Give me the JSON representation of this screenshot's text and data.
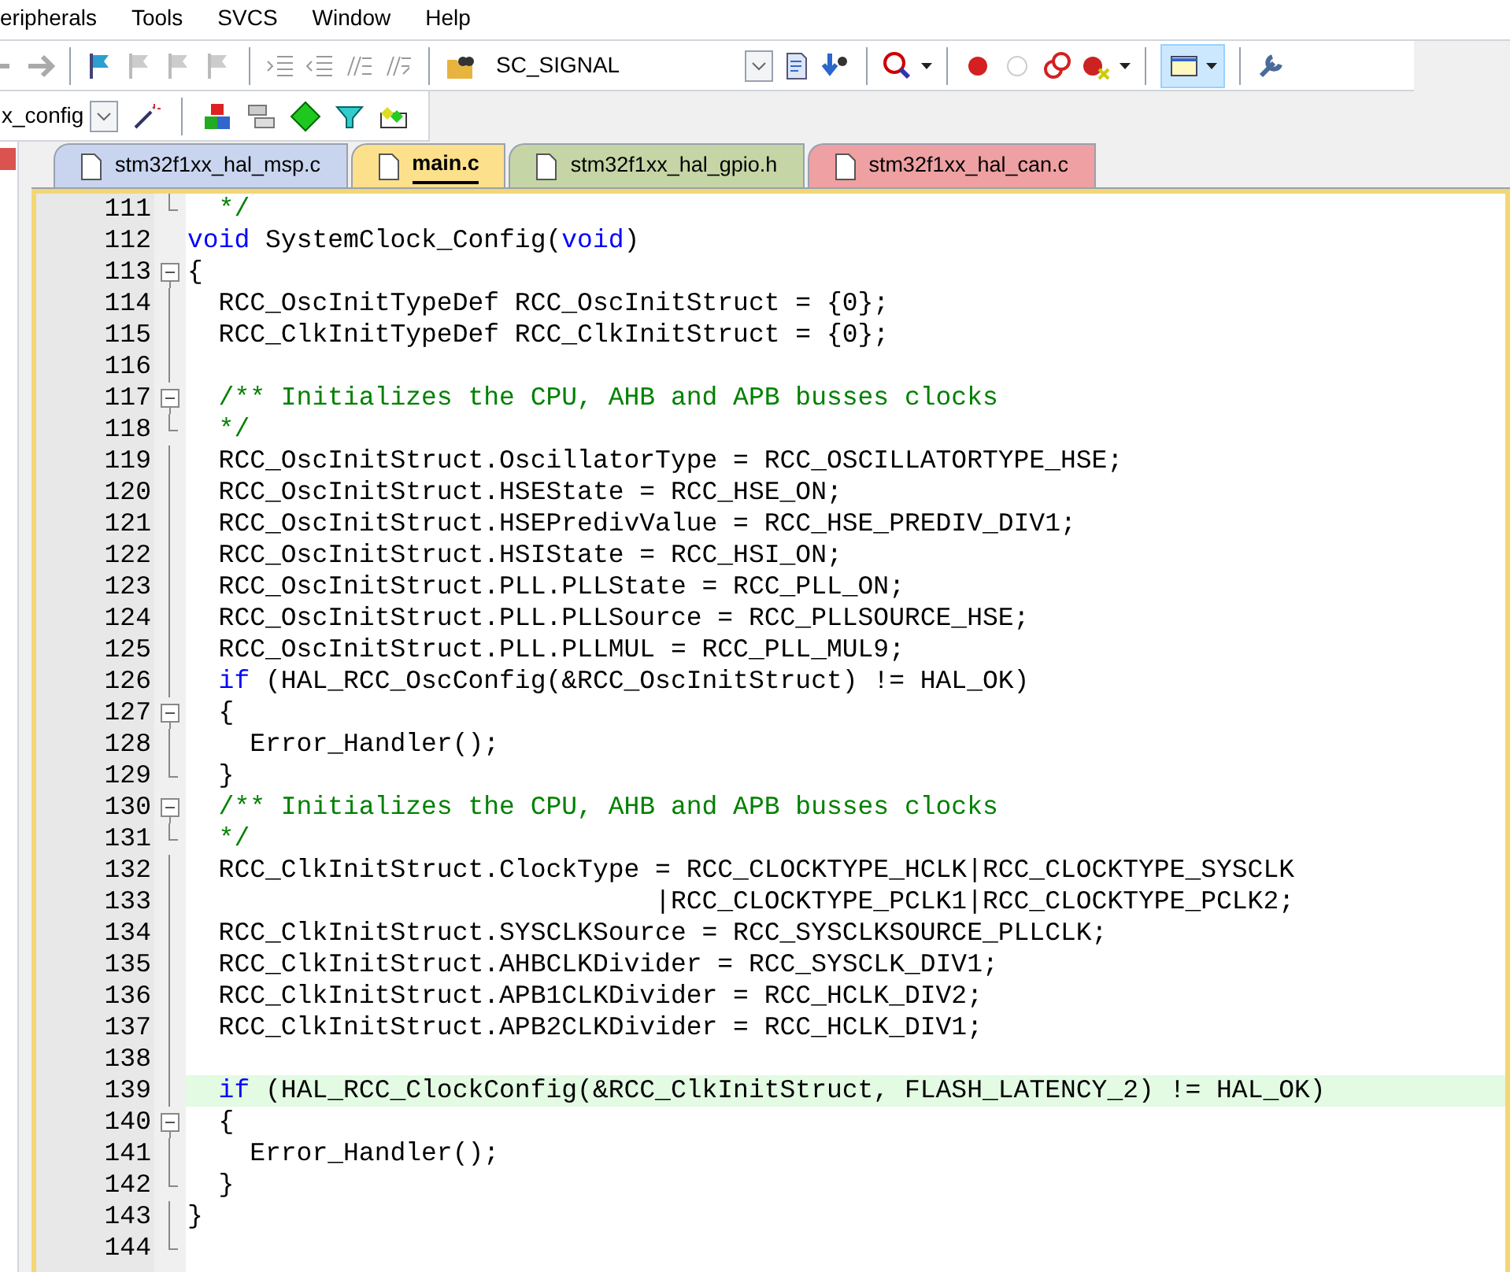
{
  "menu": [
    "eripherals",
    "Tools",
    "SVCS",
    "Window",
    "Help"
  ],
  "toolbar": {
    "signal_combo": "SC_SIGNAL",
    "target_combo": "x_config",
    "view_toggle_selected": true
  },
  "tabs": [
    {
      "label": "stm32f1xx_hal_msp.c",
      "color": "#c9d5ef",
      "selected": false
    },
    {
      "label": "main.c",
      "color": "#fde08c",
      "selected": true
    },
    {
      "label": "stm32f1xx_hal_gpio.h",
      "color": "#c5d5a6",
      "selected": false
    },
    {
      "label": "stm32f1xx_hal_can.c",
      "color": "#eea0a2",
      "selected": false
    }
  ],
  "editor": {
    "lines": [
      {
        "number": "111",
        "kind": "end",
        "highlighted": false,
        "segments": [
          {
            "kind": "comment",
            "text": "  */"
          }
        ]
      },
      {
        "number": "112",
        "kind": "plain",
        "highlighted": false,
        "segments": [
          {
            "kind": "keyword",
            "text": "void"
          },
          {
            "kind": "code",
            "text": " SystemClock_Config("
          },
          {
            "kind": "keyword",
            "text": "void"
          },
          {
            "kind": "code",
            "text": ")"
          }
        ]
      },
      {
        "number": "113",
        "kind": "open",
        "highlighted": false,
        "segments": [
          {
            "kind": "code",
            "text": "{"
          }
        ]
      },
      {
        "number": "114",
        "kind": "line",
        "highlighted": false,
        "segments": [
          {
            "kind": "code",
            "text": "  RCC_OscInitTypeDef RCC_OscInitStruct = {0};"
          }
        ]
      },
      {
        "number": "115",
        "kind": "line",
        "highlighted": false,
        "segments": [
          {
            "kind": "code",
            "text": "  RCC_ClkInitTypeDef RCC_ClkInitStruct = {0};"
          }
        ]
      },
      {
        "number": "116",
        "kind": "line",
        "highlighted": false
      },
      {
        "number": "117",
        "kind": "open",
        "highlighted": false,
        "segments": [
          {
            "kind": "comment",
            "text": "  /** Initializes the CPU, AHB and APB busses clocks"
          }
        ]
      },
      {
        "number": "118",
        "kind": "end",
        "highlighted": false,
        "segments": [
          {
            "kind": "comment",
            "text": "  */"
          }
        ]
      },
      {
        "number": "119",
        "kind": "line",
        "highlighted": false,
        "segments": [
          {
            "kind": "code",
            "text": "  RCC_OscInitStruct.OscillatorType = RCC_OSCILLATORTYPE_HSE;"
          }
        ]
      },
      {
        "number": "120",
        "kind": "line",
        "highlighted": false,
        "segments": [
          {
            "kind": "code",
            "text": "  RCC_OscInitStruct.HSEState = RCC_HSE_ON;"
          }
        ]
      },
      {
        "number": "121",
        "kind": "line",
        "highlighted": false,
        "segments": [
          {
            "kind": "code",
            "text": "  RCC_OscInitStruct.HSEPredivValue = RCC_HSE_PREDIV_DIV1;"
          }
        ]
      },
      {
        "number": "122",
        "kind": "line",
        "highlighted": false,
        "segments": [
          {
            "kind": "code",
            "text": "  RCC_OscInitStruct.HSIState = RCC_HSI_ON;"
          }
        ]
      },
      {
        "number": "123",
        "kind": "line",
        "highlighted": false,
        "segments": [
          {
            "kind": "code",
            "text": "  RCC_OscInitStruct.PLL.PLLState = RCC_PLL_ON;"
          }
        ]
      },
      {
        "number": "124",
        "kind": "line",
        "highlighted": false,
        "segments": [
          {
            "kind": "code",
            "text": "  RCC_OscInitStruct.PLL.PLLSource = RCC_PLLSOURCE_HSE;"
          }
        ]
      },
      {
        "number": "125",
        "kind": "line",
        "highlighted": false,
        "segments": [
          {
            "kind": "code",
            "text": "  RCC_OscInitStruct.PLL.PLLMUL = RCC_PLL_MUL9;"
          }
        ]
      },
      {
        "number": "126",
        "kind": "line",
        "highlighted": false,
        "segments": [
          {
            "kind": "keyword",
            "text": "  if"
          },
          {
            "kind": "code",
            "text": " (HAL_RCC_OscConfig(&RCC_OscInitStruct) != HAL_OK)"
          }
        ]
      },
      {
        "number": "127",
        "kind": "open",
        "highlighted": false,
        "segments": [
          {
            "kind": "code",
            "text": "  {"
          }
        ]
      },
      {
        "number": "128",
        "kind": "line",
        "highlighted": false,
        "segments": [
          {
            "kind": "code",
            "text": "    Error_Handler();"
          }
        ]
      },
      {
        "number": "129",
        "kind": "end",
        "highlighted": false,
        "segments": [
          {
            "kind": "code",
            "text": "  }"
          }
        ]
      },
      {
        "number": "130",
        "kind": "open",
        "highlighted": false,
        "segments": [
          {
            "kind": "comment",
            "text": "  /** Initializes the CPU, AHB and APB busses clocks"
          }
        ]
      },
      {
        "number": "131",
        "kind": "end",
        "highlighted": false,
        "segments": [
          {
            "kind": "comment",
            "text": "  */"
          }
        ]
      },
      {
        "number": "132",
        "kind": "line",
        "highlighted": false,
        "segments": [
          {
            "kind": "code",
            "text": "  RCC_ClkInitStruct.ClockType = RCC_CLOCKTYPE_HCLK|RCC_CLOCKTYPE_SYSCLK"
          }
        ]
      },
      {
        "number": "133",
        "kind": "line",
        "highlighted": false,
        "segments": [
          {
            "kind": "code",
            "text": "                              |RCC_CLOCKTYPE_PCLK1|RCC_CLOCKTYPE_PCLK2;"
          }
        ]
      },
      {
        "number": "134",
        "kind": "line",
        "highlighted": false,
        "segments": [
          {
            "kind": "code",
            "text": "  RCC_ClkInitStruct.SYSCLKSource = RCC_SYSCLKSOURCE_PLLCLK;"
          }
        ]
      },
      {
        "number": "135",
        "kind": "line",
        "highlighted": false,
        "segments": [
          {
            "kind": "code",
            "text": "  RCC_ClkInitStruct.AHBCLKDivider = RCC_SYSCLK_DIV1;"
          }
        ]
      },
      {
        "number": "136",
        "kind": "line",
        "highlighted": false,
        "segments": [
          {
            "kind": "code",
            "text": "  RCC_ClkInitStruct.APB1CLKDivider = RCC_HCLK_DIV2;"
          }
        ]
      },
      {
        "number": "137",
        "kind": "line",
        "highlighted": false,
        "segments": [
          {
            "kind": "code",
            "text": "  RCC_ClkInitStruct.APB2CLKDivider = RCC_HCLK_DIV1;"
          }
        ]
      },
      {
        "number": "138",
        "kind": "line",
        "highlighted": false
      },
      {
        "number": "139",
        "kind": "line",
        "highlighted": true,
        "segments": [
          {
            "kind": "keyword",
            "text": "  if"
          },
          {
            "kind": "code",
            "text": " (HAL_RCC_ClockConfig(&RCC_ClkInitStruct, FLASH_LATENCY_2) != HAL_OK)"
          }
        ]
      },
      {
        "number": "140",
        "kind": "open",
        "highlighted": false,
        "segments": [
          {
            "kind": "code",
            "text": "  {"
          }
        ]
      },
      {
        "number": "141",
        "kind": "line",
        "highlighted": false,
        "segments": [
          {
            "kind": "code",
            "text": "    Error_Handler();"
          }
        ]
      },
      {
        "number": "142",
        "kind": "end",
        "highlighted": false,
        "segments": [
          {
            "kind": "code",
            "text": "  }"
          }
        ]
      },
      {
        "number": "143",
        "kind": "line",
        "highlighted": false,
        "segments": [
          {
            "kind": "code",
            "text": "}"
          }
        ]
      },
      {
        "number": "144",
        "kind": "end",
        "highlighted": false
      }
    ]
  }
}
